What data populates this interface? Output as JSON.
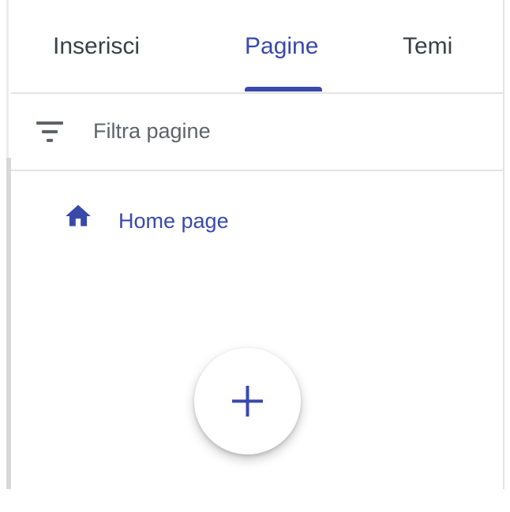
{
  "tabs": [
    {
      "label": "Inserisci",
      "active": false
    },
    {
      "label": "Pagine",
      "active": true
    },
    {
      "label": "Temi",
      "active": false
    }
  ],
  "filter": {
    "label": "Filtra pagine",
    "icon": "filter-list-icon"
  },
  "pages": [
    {
      "label": "Home page",
      "icon": "home-icon"
    }
  ],
  "fab": {
    "icon": "plus-icon"
  },
  "colors": {
    "accent": "#3949ab",
    "text_primary": "#3c4043",
    "text_secondary": "#5f6368",
    "divider": "#e3e3e3"
  }
}
